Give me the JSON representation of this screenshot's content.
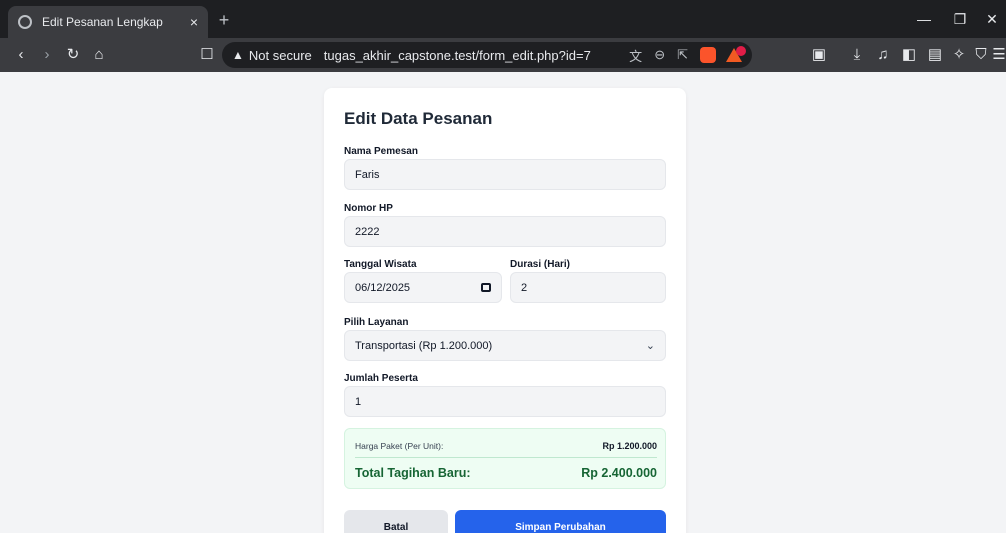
{
  "browser": {
    "tab_title": "Edit Pesanan Lengkap",
    "tab_close": "×",
    "new_tab": "+",
    "not_secure": "Not secure",
    "url": "tugas_akhir_capstone.test/form_edit.php?id=7",
    "window_controls": {
      "minimize": "—",
      "maximize": "❐",
      "close": "✕"
    }
  },
  "form": {
    "title": "Edit Data Pesanan",
    "nama_label": "Nama Pemesan",
    "nama_value": "Faris",
    "hp_label": "Nomor HP",
    "hp_value": "2222",
    "tanggal_label": "Tanggal Wisata",
    "tanggal_value": "06/12/2025",
    "durasi_label": "Durasi (Hari)",
    "durasi_value": "2",
    "layanan_label": "Pilih Layanan",
    "layanan_value": "Transportasi (Rp 1.200.000)",
    "peserta_label": "Jumlah Peserta",
    "peserta_value": "1"
  },
  "summary": {
    "unit_label": "Harga Paket (Per Unit):",
    "unit_value": "Rp 1.200.000",
    "total_label": "Total Tagihan Baru:",
    "total_value": "Rp 2.400.000"
  },
  "actions": {
    "cancel_label": "Batal",
    "save_label": "Simpan Perubahan"
  },
  "colors": {
    "primary": "#2563eb",
    "success_text": "#166534",
    "success_bg": "#eefdf3"
  }
}
